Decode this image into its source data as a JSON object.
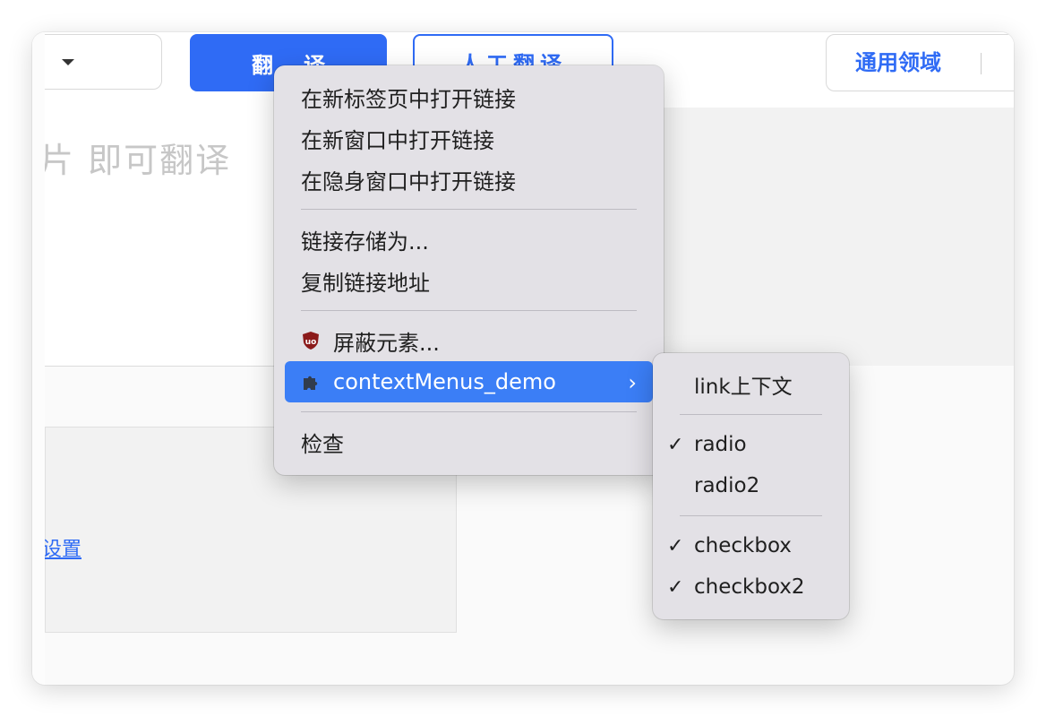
{
  "toolbar": {
    "translate_label": "翻译",
    "human_translate_label": "人工翻译",
    "domain_label": "通用领域"
  },
  "input": {
    "placeholder": "片 即可翻译"
  },
  "lower": {
    "link_text": "设置"
  },
  "context_menu": {
    "items": [
      {
        "label": "在新标签页中打开链接"
      },
      {
        "label": "在新窗口中打开链接"
      },
      {
        "label": "在隐身窗口中打开链接"
      },
      {
        "label": "链接存储为..."
      },
      {
        "label": "复制链接地址"
      },
      {
        "label": "屏蔽元素...",
        "icon": "ublock-shield-icon"
      },
      {
        "label": "contextMenus_demo",
        "icon": "puzzle-extension-icon",
        "submenu_arrow": "›"
      },
      {
        "label": "检查"
      }
    ]
  },
  "submenu": {
    "items": [
      {
        "label": "link上下文",
        "checked": false
      },
      {
        "label": "radio",
        "checked": true
      },
      {
        "label": "radio2",
        "checked": false
      },
      {
        "label": "checkbox",
        "checked": true
      },
      {
        "label": "checkbox2",
        "checked": true
      }
    ],
    "check_glyph": "✓"
  },
  "colors": {
    "accent": "#2f6bf5",
    "menu_bg": "#e3e1e6",
    "menu_highlight": "#3b7ef6",
    "ublock_red": "#8b1a1a"
  }
}
